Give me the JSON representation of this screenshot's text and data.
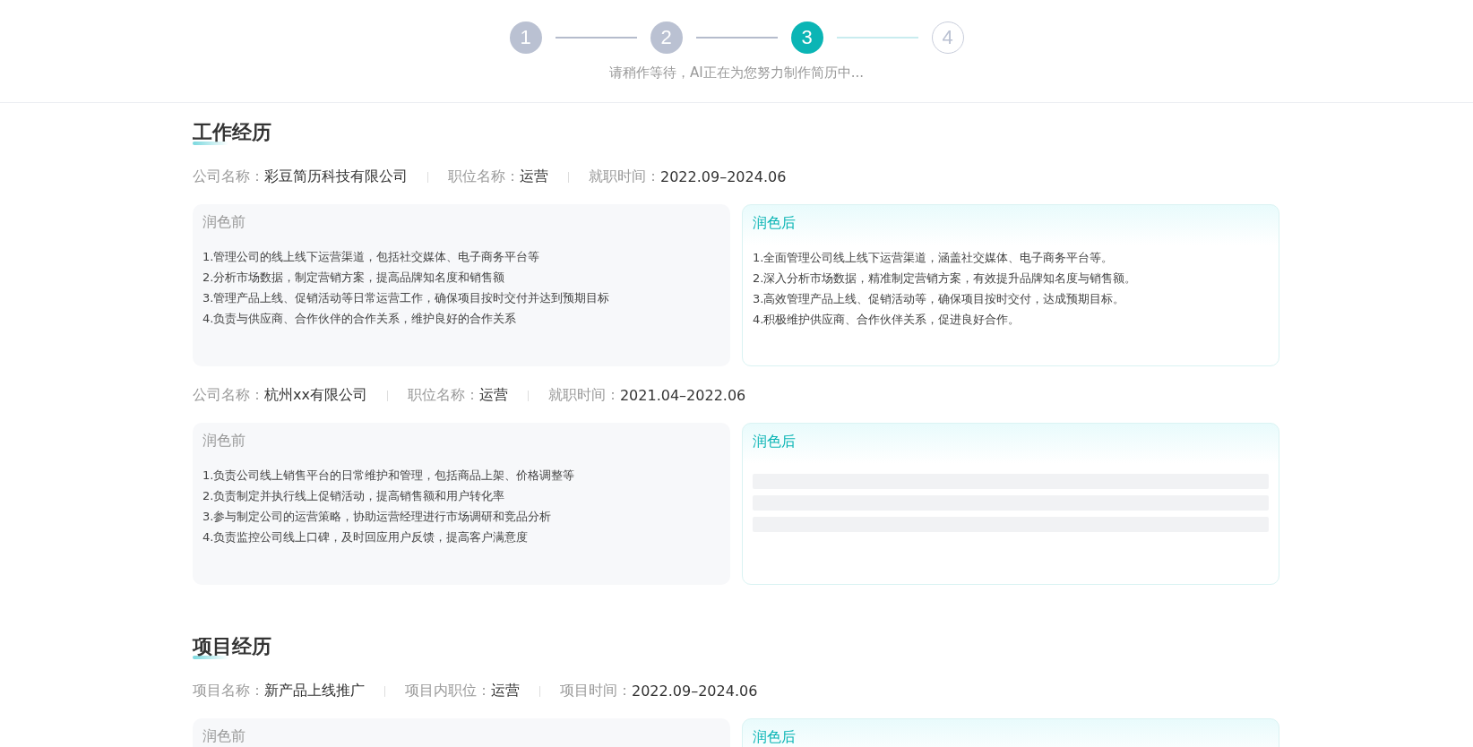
{
  "stepper": {
    "steps": [
      {
        "label": "1",
        "done": true,
        "selected": false
      },
      {
        "label": "2",
        "done": true,
        "selected": false
      },
      {
        "label": "3",
        "done": false,
        "selected": true
      },
      {
        "label": "4",
        "done": false,
        "selected": false
      }
    ],
    "caption": "请稍作等待，AI正在为您努力制作简历中..."
  },
  "sections": [
    {
      "title": "工作经历",
      "entries": [
        {
          "meta": [
            {
              "label": "公司名称：",
              "value": "彩豆简历科技有限公司"
            },
            {
              "label": "职位名称：",
              "value": "运营"
            },
            {
              "label": "就职时间：",
              "value": "2022.09–2024.06"
            }
          ],
          "before": {
            "title": "润色前",
            "lines": [
              "1.管理公司的线上线下运营渠道，包括社交媒体、电子商务平台等",
              "2.分析市场数据，制定营销方案，提高品牌知名度和销售额",
              "3.管理产品上线、促销活动等日常运营工作，确保项目按时交付并达到预期目标",
              "4.负责与供应商、合作伙伴的合作关系，维护良好的合作关系"
            ]
          },
          "after": {
            "title": "润色后",
            "loading": false,
            "lines": [
              "1.全面管理公司线上线下运营渠道，涵盖社交媒体、电子商务平台等。",
              "2.深入分析市场数据，精准制定营销方案，有效提升品牌知名度与销售额。",
              "3.高效管理产品上线、促销活动等，确保项目按时交付，达成预期目标。",
              "4.积极维护供应商、合作伙伴关系，促进良好合作。"
            ]
          }
        },
        {
          "meta": [
            {
              "label": "公司名称：",
              "value": "杭州xx有限公司"
            },
            {
              "label": "职位名称：",
              "value": "运营"
            },
            {
              "label": "就职时间：",
              "value": "2021.04–2022.06"
            }
          ],
          "before": {
            "title": "润色前",
            "lines": [
              "1.负责公司线上销售平台的日常维护和管理，包括商品上架、价格调整等",
              "2.负责制定并执行线上促销活动，提高销售额和用户转化率",
              "3.参与制定公司的运营策略，协助运营经理进行市场调研和竞品分析",
              "4.负责监控公司线上口碑，及时回应用户反馈，提高客户满意度"
            ]
          },
          "after": {
            "title": "润色后",
            "loading": true
          }
        }
      ]
    },
    {
      "title": "项目经历",
      "entries": [
        {
          "meta": [
            {
              "label": "项目名称：",
              "value": "新产品上线推广"
            },
            {
              "label": "项目内职位：",
              "value": "运营"
            },
            {
              "label": "项目时间：",
              "value": "2022.09–2024.06"
            }
          ],
          "before": {
            "title": "润色前"
          },
          "after": {
            "title": "润色后"
          }
        }
      ]
    }
  ]
}
